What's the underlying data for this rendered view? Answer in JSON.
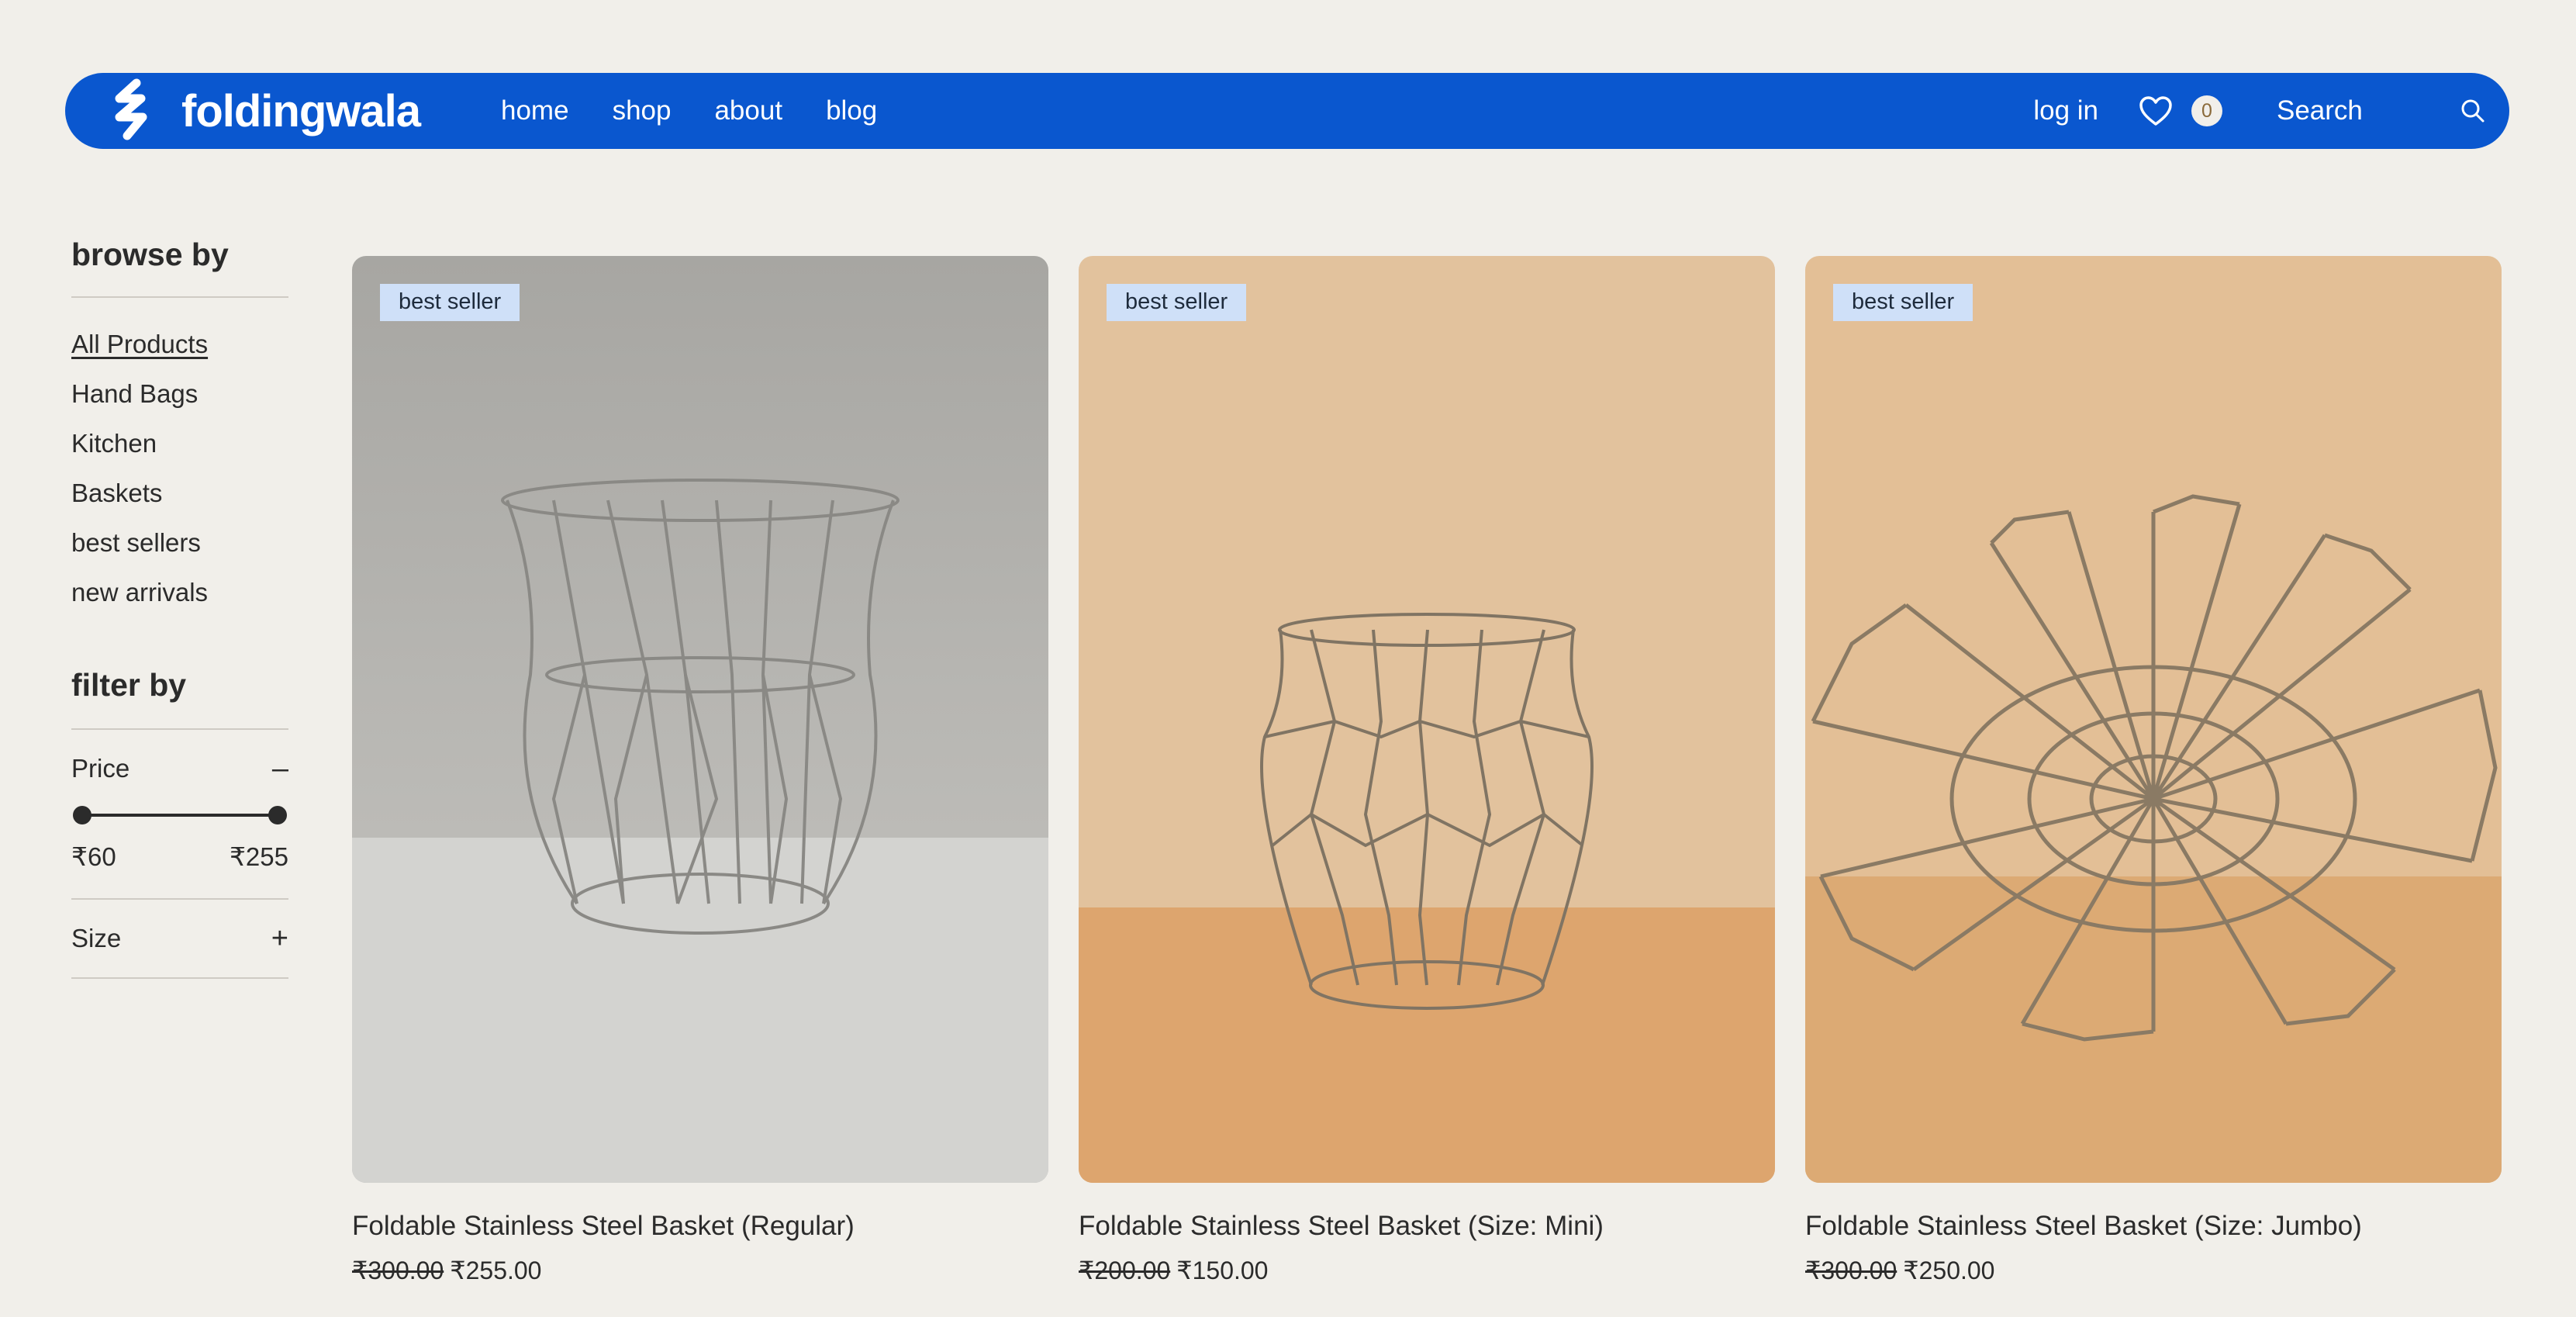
{
  "brand": {
    "name": "foldingwala"
  },
  "nav": [
    "home",
    "shop",
    "about",
    "blog"
  ],
  "header": {
    "login": "log in",
    "wishlist_count": "0",
    "search_label": "Search"
  },
  "sidebar": {
    "browse_title": "browse by",
    "browse_items": [
      "All Products",
      "Hand Bags",
      "Kitchen",
      "Baskets",
      "best sellers",
      "new arrivals"
    ],
    "active_item": "All Products",
    "filter_title": "filter by",
    "price_label": "Price",
    "price_toggle": "–",
    "price_min": "₹60",
    "price_max": "₹255",
    "size_label": "Size",
    "size_toggle": "+"
  },
  "products": [
    {
      "tag": "best seller",
      "name": "Foldable Stainless Steel Basket (Regular)",
      "old_price": "₹300.00",
      "price": "₹255.00"
    },
    {
      "tag": "best seller",
      "name": "Foldable Stainless Steel Basket (Size: Mini)",
      "old_price": "₹200.00",
      "price": "₹150.00"
    },
    {
      "tag": "best seller",
      "name": "Foldable Stainless Steel Basket (Size: Jumbo)",
      "old_price": "₹300.00",
      "price": "₹250.00"
    }
  ],
  "colors": {
    "header": "#0a57cf",
    "background": "#f1efea",
    "tag": "#cfe0f8"
  }
}
